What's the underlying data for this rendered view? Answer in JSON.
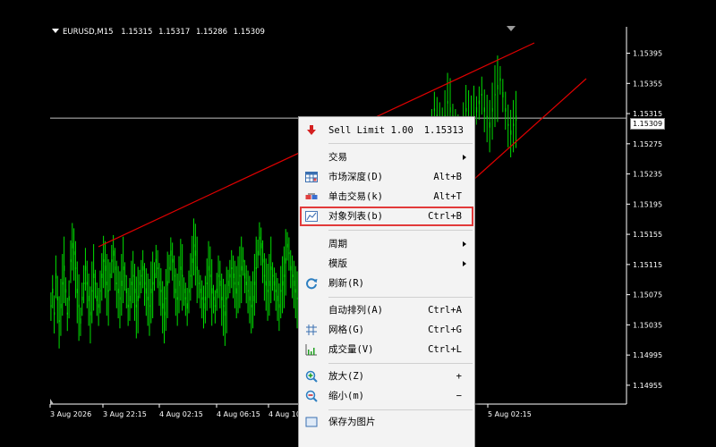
{
  "header": {
    "symbol": "EURUSD,M15",
    "open": "1.15315",
    "high": "1.15317",
    "low": "1.15286",
    "close": "1.15309"
  },
  "price_axis": {
    "labels": [
      "1.15395",
      "1.15355",
      "1.15315",
      "1.15275",
      "1.15235",
      "1.15195",
      "1.15155",
      "1.15115",
      "1.15075",
      "1.15035",
      "1.14995",
      "1.14955"
    ],
    "current_price": "1.15309"
  },
  "time_axis": {
    "labels": [
      "3 Aug 2026",
      "3 Aug 22:15",
      "4 Aug 02:15",
      "4 Aug 06:15",
      "4 Aug 10",
      "5 Aug 02:15"
    ]
  },
  "colors": {
    "background": "#000000",
    "candle": "#00e000",
    "trendline": "#e00000",
    "grid_line": "#c0c0c0",
    "menu_bg": "#f3f3f3",
    "highlight": "#e23a3a"
  },
  "context_menu": {
    "sell_limit": {
      "label": "Sell Limit 1.00",
      "price": "1.15313",
      "icon": "sell-arrow-icon"
    },
    "trade": {
      "label": "交易",
      "has_submenu": true
    },
    "market_depth": {
      "label": "市场深度(D)",
      "shortcut": "Alt+B",
      "icon": "depth-of-market-icon"
    },
    "one_click": {
      "label": "单击交易(k)",
      "shortcut": "Alt+T",
      "icon": "one-click-trading-icon"
    },
    "object_list": {
      "label": "对象列表(b)",
      "shortcut": "Ctrl+B",
      "icon": "object-list-icon"
    },
    "period": {
      "label": "周期",
      "has_submenu": true
    },
    "template": {
      "label": "模版",
      "has_submenu": true
    },
    "refresh": {
      "label": "刷新(R)",
      "icon": "refresh-icon"
    },
    "auto_arrange": {
      "label": "自动排列(A)",
      "shortcut": "Ctrl+A"
    },
    "grid": {
      "label": "网格(G)",
      "shortcut": "Ctrl+G",
      "icon": "grid-icon"
    },
    "volume": {
      "label": "成交量(V)",
      "shortcut": "Ctrl+L",
      "icon": "volume-icon"
    },
    "zoom_in": {
      "label": "放大(Z)",
      "shortcut": "+",
      "icon": "zoom-in-icon"
    },
    "zoom_out": {
      "label": "缩小(m)",
      "shortcut": "−",
      "icon": "zoom-out-icon"
    },
    "save_picture": {
      "label": "保存为图片",
      "icon": "save-picture-icon"
    }
  },
  "chart_data": {
    "type": "candlestick",
    "symbol": "EURUSD",
    "timeframe": "M15",
    "ylim": [
      1.1493,
      1.1543
    ],
    "trendlines": [
      {
        "from": [
          "3 Aug 22:15",
          1.1515
        ],
        "to": [
          "5 Aug 02:15",
          1.1541
        ]
      },
      {
        "from": [
          "4 Aug 10",
          1.15175
        ],
        "to": [
          "5 Aug 02:15",
          1.15375
        ]
      }
    ],
    "horizontal_line": 1.15309,
    "price_series": [
      1.1506,
      1.1508,
      1.1505,
      1.151,
      1.1507,
      1.1504,
      1.1506,
      1.1509,
      1.1511,
      1.1508,
      1.1505,
      1.1507,
      1.1512,
      1.1514,
      1.1513,
      1.1511,
      1.1508,
      1.1506,
      1.1504,
      1.1507,
      1.1509,
      1.1511,
      1.1509,
      1.1507,
      1.1505,
      1.1508,
      1.151,
      1.1509,
      1.1507,
      1.1506,
      1.1508,
      1.151,
      1.1512,
      1.1511,
      1.1509,
      1.1508,
      1.151,
      1.1512,
      1.1513,
      1.1511,
      1.1509,
      1.1508,
      1.1507,
      1.1509,
      1.1511,
      1.151,
      1.1508,
      1.1506,
      1.1507,
      1.1509,
      1.151,
      1.1508,
      1.1506,
      1.1507,
      1.1509,
      1.151,
      1.1511,
      1.1509,
      1.1508,
      1.1507,
      1.1506,
      1.1508,
      1.1509,
      1.151,
      1.1512,
      1.1511,
      1.1509,
      1.1508,
      1.1506,
      1.1505,
      1.1507,
      1.1509,
      1.1511,
      1.1513,
      1.1512,
      1.151,
      1.1508,
      1.1507,
      1.1509,
      1.1511,
      1.151,
      1.1508,
      1.1507,
      1.1506,
      1.1508,
      1.151,
      1.1512,
      1.1514,
      1.1513,
      1.1511,
      1.1509,
      1.1508,
      1.1507,
      1.1506,
      1.1507,
      1.1509,
      1.1511,
      1.151,
      1.1508,
      1.1507,
      1.1506,
      1.1508,
      1.151,
      1.1509,
      1.1507,
      1.1506,
      1.1505,
      1.1507,
      1.1509,
      1.151,
      1.1511,
      1.151,
      1.1509,
      1.1508,
      1.1509,
      1.151,
      1.1511,
      1.1512,
      1.151,
      1.1509,
      1.1508,
      1.1507,
      1.1506,
      1.1507,
      1.1509,
      1.1511,
      1.1513,
      1.1515,
      1.1514,
      1.1512,
      1.151,
      1.1509,
      1.1508,
      1.1509,
      1.1511,
      1.151,
      1.1509,
      1.1508,
      1.1507,
      1.1506,
      1.1508,
      1.1509,
      1.151,
      1.1512,
      1.1514,
      1.1513,
      1.1511,
      1.151,
      1.1509,
      1.1508,
      1.1507
    ],
    "right_series": [
      1.1529,
      1.153,
      1.1532,
      1.1531,
      1.153,
      1.1529,
      1.1531,
      1.1533,
      1.1532,
      1.1531,
      1.153,
      1.1529,
      1.1528,
      1.153,
      1.1532,
      1.1531,
      1.153,
      1.1531,
      1.1532,
      1.1533,
      1.1534,
      1.1532,
      1.1531,
      1.153,
      1.1532,
      1.1534,
      1.1535,
      1.1536,
      1.1534,
      1.1532,
      1.153,
      1.1529,
      1.153,
      1.15309
    ]
  }
}
